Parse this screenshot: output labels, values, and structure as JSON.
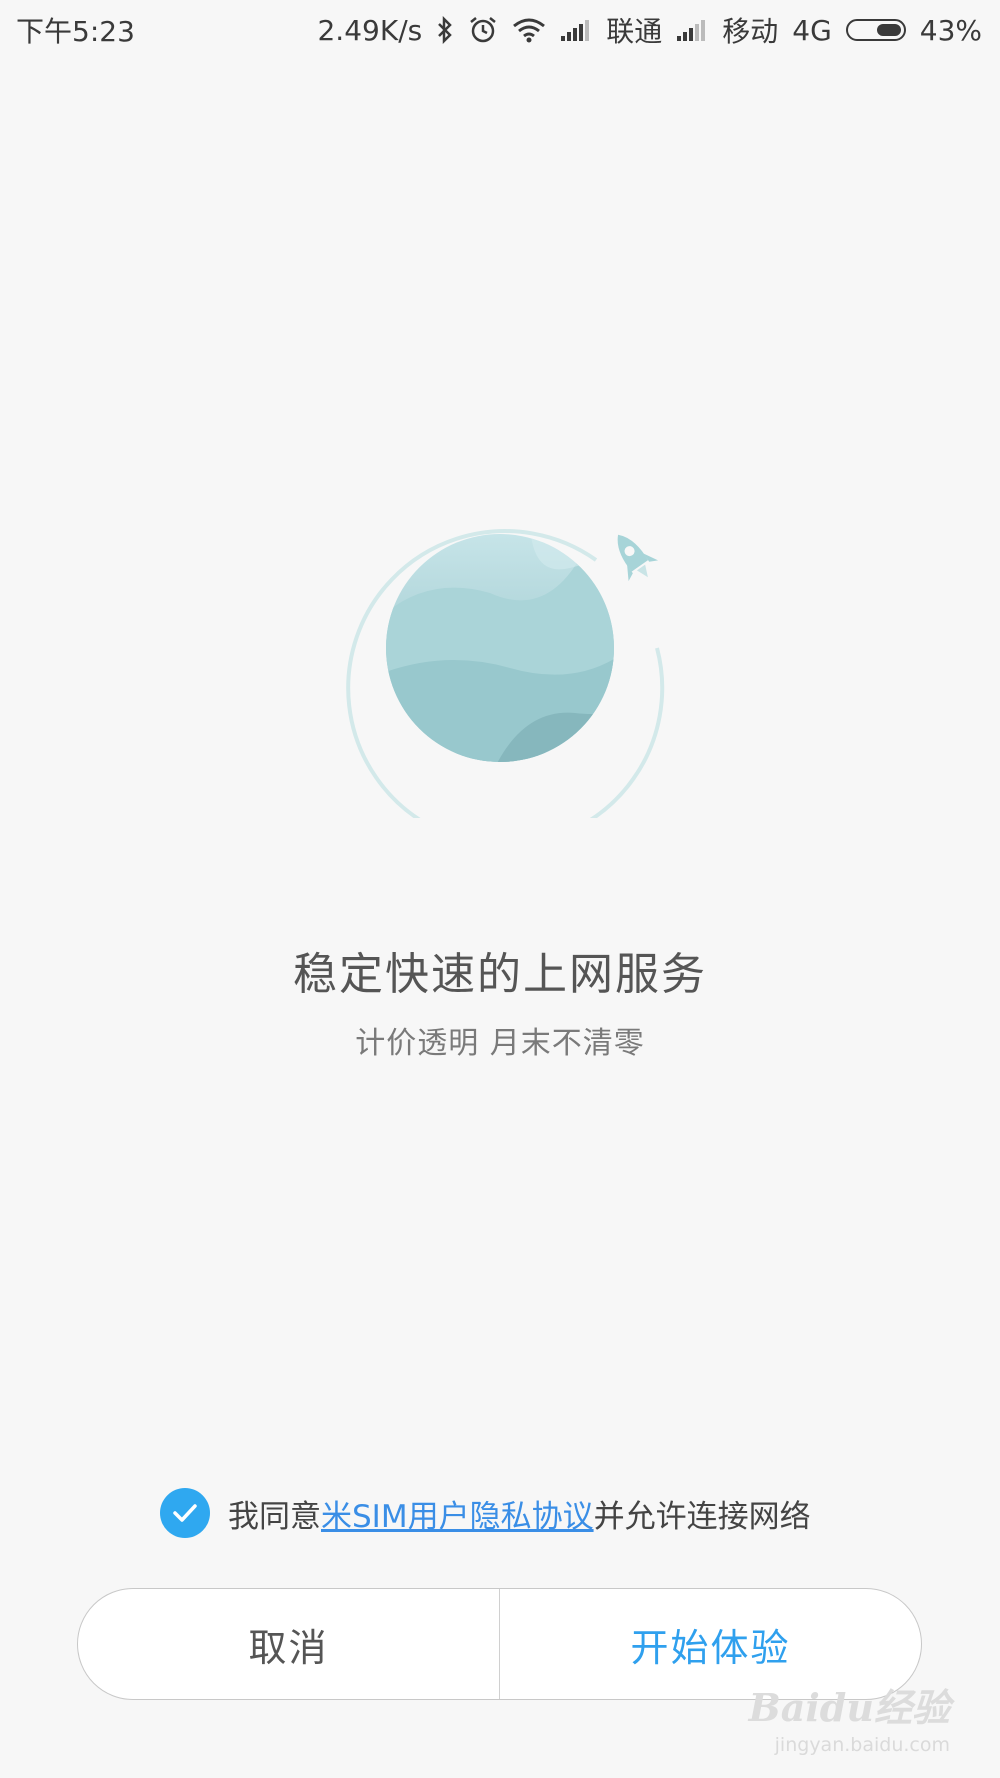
{
  "status_bar": {
    "time": "下午5:23",
    "net_speed": "2.49K/s",
    "carrier1": "联通",
    "carrier2": "移动",
    "network_type": "4G",
    "battery_level": 0.43,
    "battery": "43%",
    "icons": [
      "bluetooth-icon",
      "alarm-icon",
      "wifi-icon",
      "signal-icon",
      "signal-icon",
      "battery-icon"
    ]
  },
  "main": {
    "headline": "稳定快速的上网服务",
    "subline": "计价透明 月末不清零"
  },
  "agreement": {
    "checked": true,
    "prefix": "我同意",
    "link": "米SIM用户隐私协议",
    "suffix": "并允许连接网络"
  },
  "buttons": {
    "cancel": "取消",
    "start": "开始体验"
  },
  "watermark": {
    "brand": "Baidu经验",
    "url": "jingyan.baidu.com"
  },
  "colors": {
    "accent": "#2fa8f0",
    "link": "#3a8ee6",
    "background": "#f7f7f7",
    "planet": "#a7d4d8"
  }
}
